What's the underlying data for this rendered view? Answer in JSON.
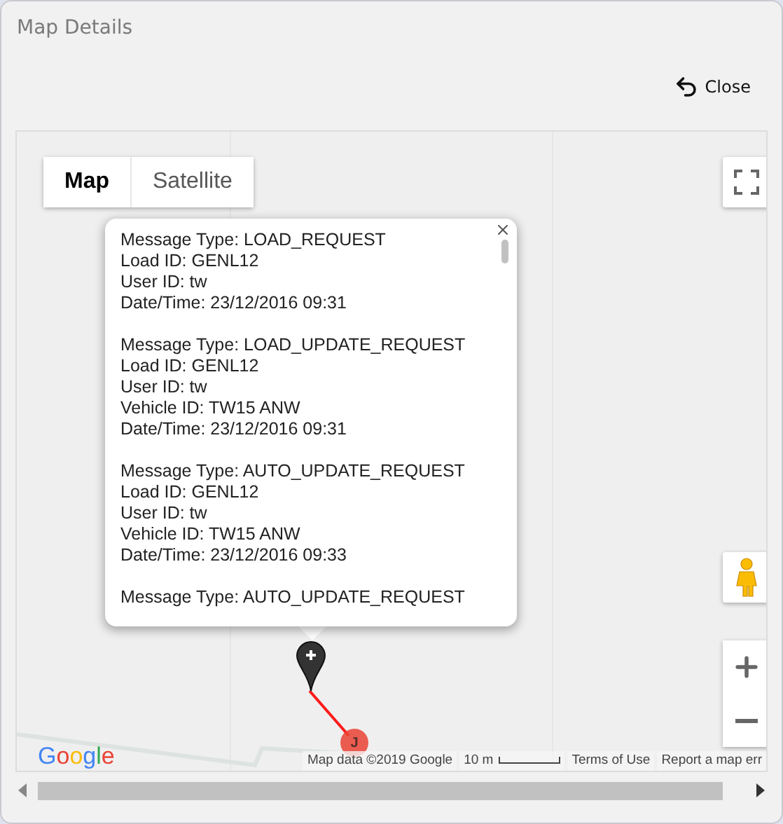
{
  "dialog": {
    "title": "Map Details",
    "close_button": "Close"
  },
  "map": {
    "type_tabs": [
      {
        "label": "Map",
        "selected": true
      },
      {
        "label": "Satellite",
        "selected": false
      }
    ],
    "info_window": {
      "messages": [
        [
          "Message Type: LOAD_REQUEST",
          "Load ID: GENL12",
          "User ID: tw",
          "Date/Time: 23/12/2016 09:31"
        ],
        [
          "Message Type: LOAD_UPDATE_REQUEST",
          "Load ID: GENL12",
          "User ID: tw",
          "Vehicle ID: TW15 ANW",
          "Date/Time: 23/12/2016 09:31"
        ],
        [
          "Message Type: AUTO_UPDATE_REQUEST",
          "Load ID: GENL12",
          "User ID: tw",
          "Vehicle ID: TW15 ANW",
          "Date/Time: 23/12/2016 09:33"
        ],
        [
          "Message Type: AUTO_UPDATE_REQUEST"
        ]
      ]
    },
    "markers": [
      {
        "kind": "pin"
      },
      {
        "kind": "circle",
        "label": "J"
      }
    ],
    "logo": "Google",
    "attribution": "Map data ©2019 Google",
    "scale": "10 m",
    "terms_link": "Terms of Use",
    "report_link": "Report a map err"
  }
}
